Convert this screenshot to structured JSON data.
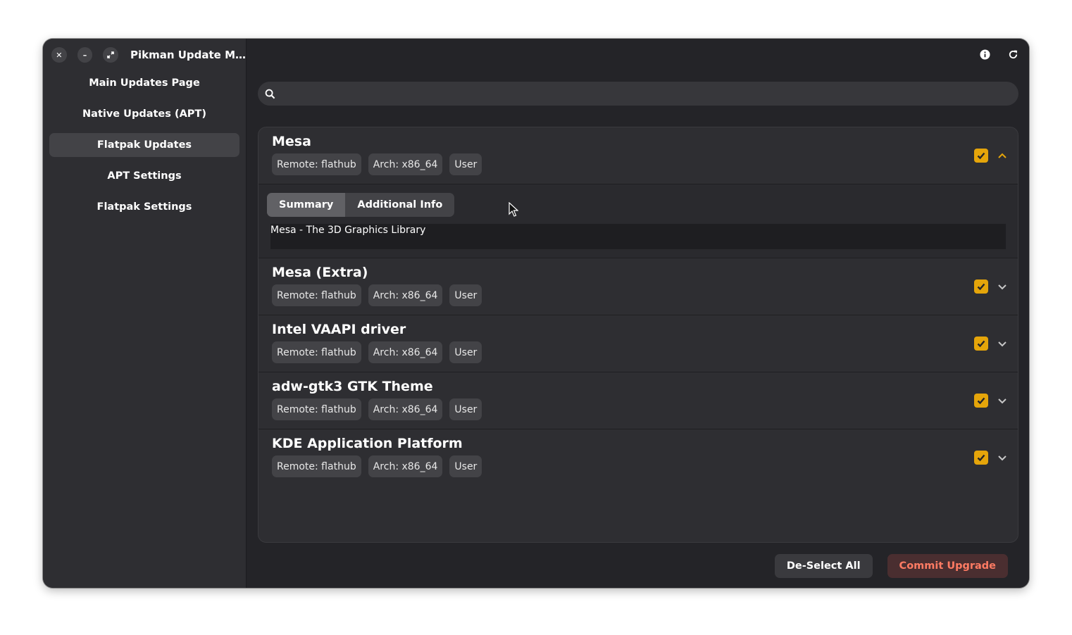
{
  "window": {
    "title": "Pikman Update M…",
    "controls": {
      "close": "close-icon",
      "minimize": "minimize-icon",
      "maximize": "maximize-icon"
    }
  },
  "sidebar": {
    "items": [
      {
        "label": "Main Updates Page",
        "active": false
      },
      {
        "label": "Native Updates (APT)",
        "active": false
      },
      {
        "label": "Flatpak Updates",
        "active": true
      },
      {
        "label": "APT Settings",
        "active": false
      },
      {
        "label": "Flatpak Settings",
        "active": false
      }
    ]
  },
  "header": {
    "icons": [
      "info-icon",
      "refresh-icon"
    ]
  },
  "search": {
    "placeholder": "",
    "value": "",
    "icon": "search-icon"
  },
  "packages": [
    {
      "name": "Mesa",
      "remote": "Remote: flathub",
      "arch": "Arch: x86_64",
      "scope": "User",
      "checked": true,
      "expanded": true
    },
    {
      "name": "Mesa (Extra)",
      "remote": "Remote: flathub",
      "arch": "Arch: x86_64",
      "scope": "User",
      "checked": true,
      "expanded": false
    },
    {
      "name": "Intel VAAPI driver",
      "remote": "Remote: flathub",
      "arch": "Arch: x86_64",
      "scope": "User",
      "checked": true,
      "expanded": false
    },
    {
      "name": "adw-gtk3 GTK Theme",
      "remote": "Remote: flathub",
      "arch": "Arch: x86_64",
      "scope": "User",
      "checked": true,
      "expanded": false
    },
    {
      "name": "KDE Application Platform",
      "remote": "Remote: flathub",
      "arch": "Arch: x86_64",
      "scope": "User",
      "checked": true,
      "expanded": false
    }
  ],
  "details": {
    "tabs": [
      "Summary",
      "Additional Info"
    ],
    "active_tab": "Summary",
    "summary_text": "Mesa - The 3D Graphics Library"
  },
  "actions": {
    "deselect_label": "De-Select All",
    "commit_label": "Commit Upgrade"
  },
  "colors": {
    "accent_check": "#e5a50a",
    "commit_text": "#ff7b63",
    "commit_bg": "#4a2e30"
  }
}
